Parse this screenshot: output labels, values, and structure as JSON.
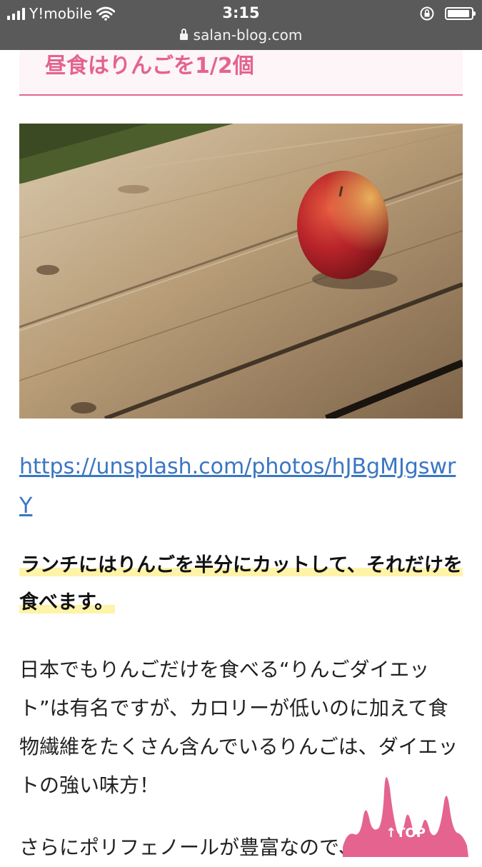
{
  "status_bar": {
    "carrier": "Y!mobile",
    "time": "3:15",
    "url": "salan-blog.com"
  },
  "article": {
    "heading": "昼食はりんごを1/2個",
    "image": {
      "subject": "apple on wooden table"
    },
    "link": "https://unsplash.com/photos/hJBgMJgswrY",
    "lead": "ランチにはりんごを半分にカットして、それだけを食べます。",
    "paragraph_1": "日本でもりんごだけを食べる“りんごダイエット”は有名ですが、カロリーが低いのに加えて食物繊維をたくさん含んでいるりんごは、ダイエットの強い味方！",
    "paragraph_2": "さらにポリフェノールが豊富なので、美肌に"
  },
  "top_button": {
    "label": "↑TOP",
    "color": "#e4648f"
  },
  "colors": {
    "accent": "#e4648f",
    "link": "#3b76c1",
    "marker": "#fff3a8",
    "status_bar": "#5a5a5a"
  }
}
